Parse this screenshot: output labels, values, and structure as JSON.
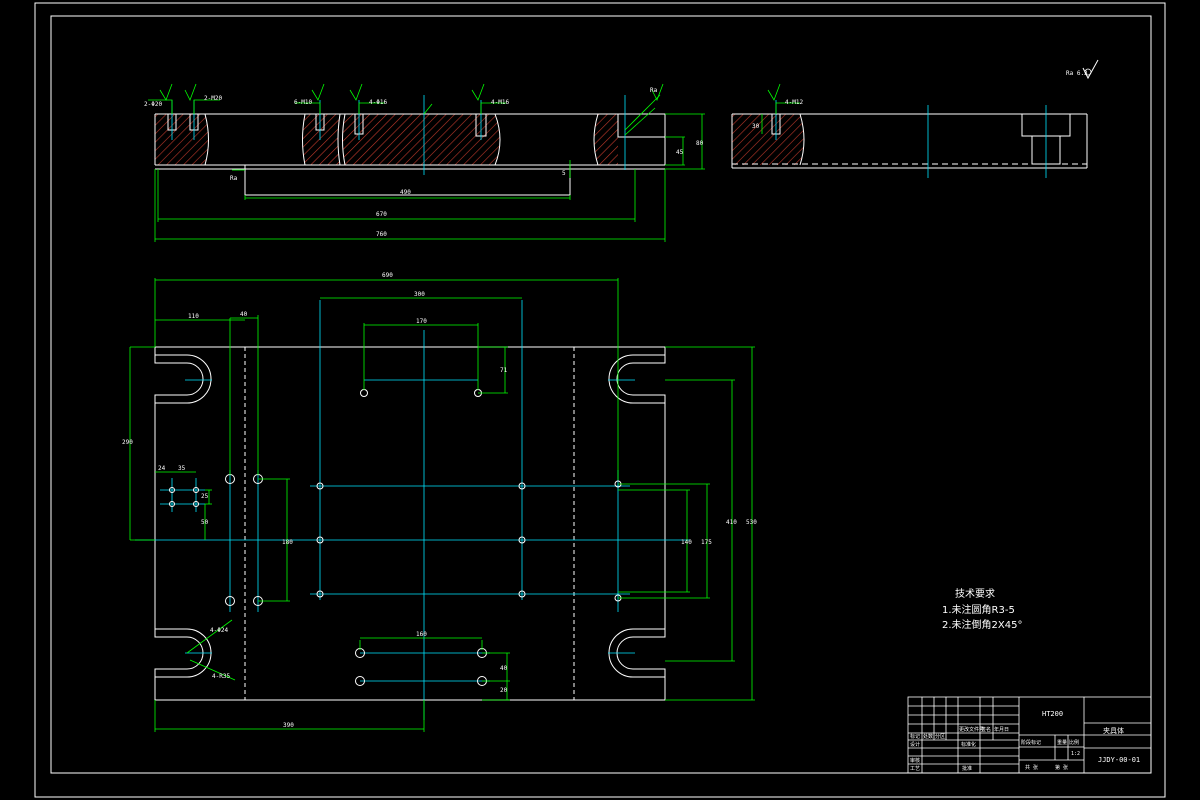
{
  "drawing": {
    "background": "#000000",
    "colors": {
      "outline": "#ffffff",
      "dimension": "#00ff00",
      "centerline": "#00e5ff",
      "hatch": "#c0392b",
      "text": "#ffffff"
    },
    "roughness_symbol": "Ra 6.3",
    "section_view": {
      "dims": {
        "d490": "490",
        "d670": "670",
        "d760": "760",
        "d45": "45",
        "d80": "80",
        "d5": "5"
      },
      "callouts": {
        "c1": "2-Φ20",
        "c2": "2-M20",
        "c3": "6-M10",
        "c4": "4-Φ16",
        "c5": "4-M16",
        "c6": "Ra",
        "c7": "Ra"
      }
    },
    "side_view": {
      "callout": "4-M12",
      "dim": "30"
    },
    "plan_view": {
      "dims": {
        "d690": "690",
        "d300": "300",
        "d170": "170",
        "d110": "110",
        "d40": "40",
        "d71": "71",
        "d290": "290",
        "d24": "24",
        "d35": "35",
        "d25": "25",
        "d50": "50",
        "d180": "180",
        "d140": "140",
        "d175": "175",
        "d410": "410",
        "d530": "530",
        "d160": "160",
        "d40b": "40",
        "d20": "20",
        "d390": "390",
        "r1": "4-Φ24",
        "r2": "4-R35"
      }
    },
    "technical_requirements": {
      "title": "技术要求",
      "items": [
        "1.未注圆角R3-5",
        "2.未注倒角2X45°"
      ]
    },
    "title_block": {
      "material": "HT200",
      "part_name": "夹具体",
      "drawing_number": "JJDY-00-01",
      "scale": "1:2",
      "labels": [
        "标记",
        "处数",
        "分区",
        "更改文件号",
        "签名",
        "年月日",
        "设计",
        "标准化",
        "阶段标记",
        "重量",
        "比例",
        "审核",
        "工艺",
        "批准",
        "共 张",
        "第 张"
      ]
    }
  }
}
